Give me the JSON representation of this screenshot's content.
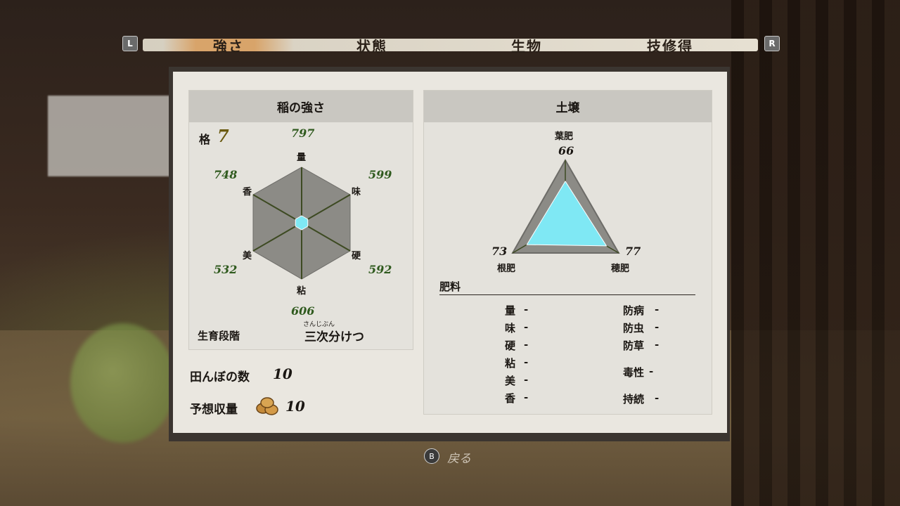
{
  "tabs": [
    {
      "label": "強さ"
    },
    {
      "label": "状態"
    },
    {
      "label": "生物"
    },
    {
      "label": "技修得"
    }
  ],
  "shoulder_left": "L",
  "shoulder_right": "R",
  "rice": {
    "title": "稲の強さ",
    "rank_label": "格",
    "rank_value": "7",
    "stats": [
      {
        "label": "量",
        "value": "797"
      },
      {
        "label": "味",
        "value": "599"
      },
      {
        "label": "硬",
        "value": "592"
      },
      {
        "label": "粘",
        "value": "606"
      },
      {
        "label": "美",
        "value": "532"
      },
      {
        "label": "香",
        "value": "748"
      }
    ],
    "growth_label": "生育段階",
    "growth_ruby": "さんじぶん",
    "growth_value": "三次分けつ"
  },
  "field_count_label": "田んぼの数",
  "field_count_value": "10",
  "yield_label": "予想収量",
  "yield_value": "10",
  "soil": {
    "title": "土壌",
    "leaf": {
      "label": "葉肥",
      "value": "66"
    },
    "root": {
      "label": "根肥",
      "value": "73"
    },
    "ear": {
      "label": "穂肥",
      "value": "77"
    }
  },
  "fertilizer": {
    "title": "肥料",
    "left": [
      {
        "label": "量",
        "value": "-"
      },
      {
        "label": "味",
        "value": "-"
      },
      {
        "label": "硬",
        "value": "-"
      },
      {
        "label": "粘",
        "value": "-"
      },
      {
        "label": "美",
        "value": "-"
      },
      {
        "label": "香",
        "value": "-"
      }
    ],
    "right": [
      {
        "label": "防病",
        "value": "-"
      },
      {
        "label": "防虫",
        "value": "-"
      },
      {
        "label": "防草",
        "value": "-"
      },
      {
        "label": "毒性",
        "value": "-"
      },
      {
        "label": "持続",
        "value": "-"
      }
    ]
  },
  "back": {
    "button": "B",
    "label": "戻る"
  },
  "colors": {
    "radar_fill": "#7fe8f4",
    "hex_fill": "#8c8b86",
    "axis": "#3d4a22"
  }
}
